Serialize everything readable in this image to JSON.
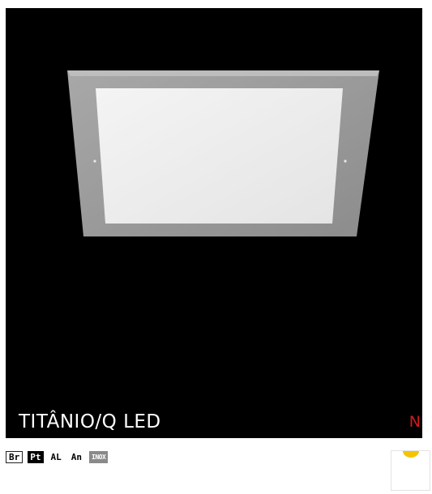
{
  "product": {
    "name": "TITÂNIO/Q LED",
    "badge": "N",
    "badge_color": "#d11a1a"
  },
  "finishes": [
    "Br",
    "Pt",
    "AL",
    "An",
    "INOX"
  ],
  "icons": {
    "lamp": "led-bulb-icon"
  }
}
